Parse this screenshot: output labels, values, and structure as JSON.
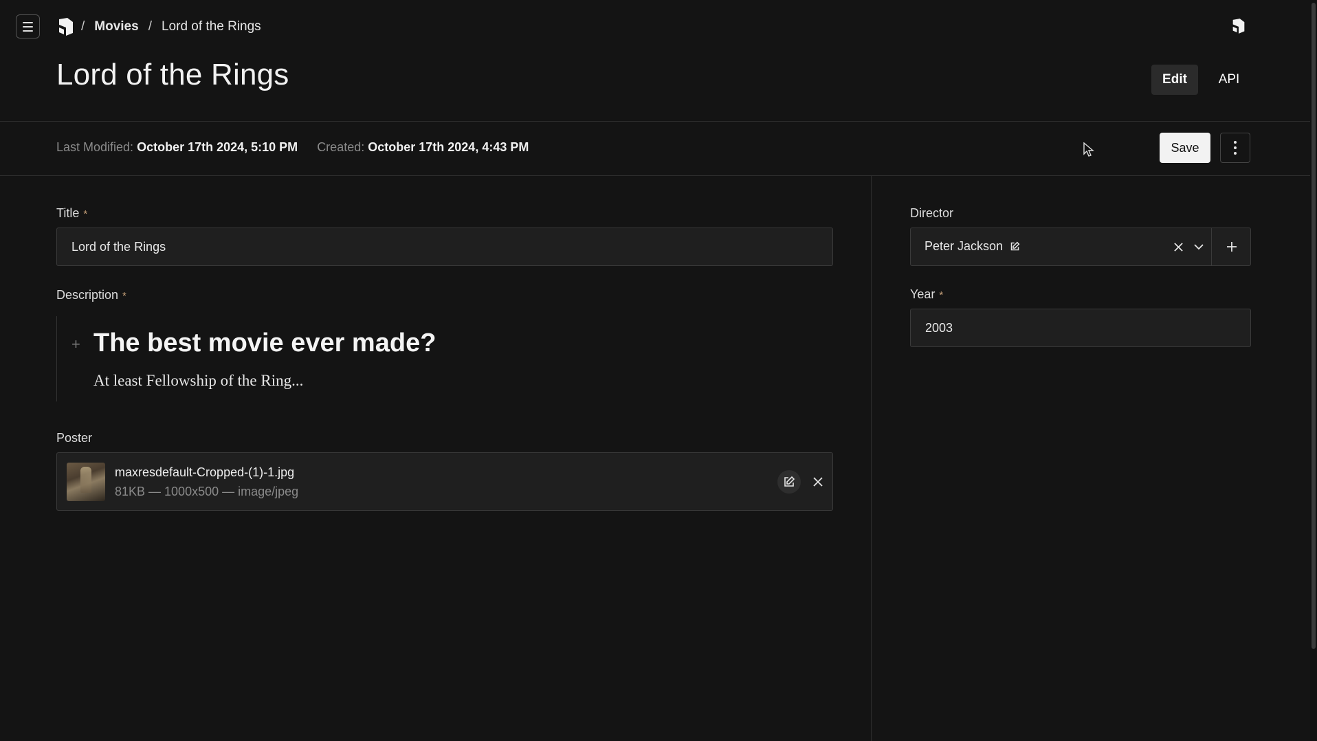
{
  "breadcrumb": {
    "collection": "Movies",
    "current": "Lord of the Rings"
  },
  "page": {
    "title": "Lord of the Rings"
  },
  "tabs": {
    "edit": "Edit",
    "api": "API"
  },
  "meta": {
    "last_modified_label": "Last Modified:",
    "last_modified_value": "October 17th 2024, 5:10 PM",
    "created_label": "Created:",
    "created_value": "October 17th 2024, 4:43 PM"
  },
  "toolbar": {
    "save_label": "Save"
  },
  "fields": {
    "title": {
      "label": "Title",
      "required_mark": "*",
      "value": "Lord of the Rings"
    },
    "description": {
      "label": "Description",
      "required_mark": "*",
      "heading": "The best movie ever made?",
      "paragraph": "At least Fellowship of the Ring..."
    },
    "poster": {
      "label": "Poster",
      "filename": "maxresdefault-Cropped-(1)-1.jpg",
      "details": "81KB — 1000x500 — image/jpeg"
    },
    "director": {
      "label": "Director",
      "value": "Peter Jackson"
    },
    "year": {
      "label": "Year",
      "required_mark": "*",
      "value": "2003"
    }
  },
  "icons": {
    "menu": "hamburger-icon",
    "logo": "payload-logo-icon",
    "more": "vertical-ellipsis-icon",
    "edit": "pencil-square-icon",
    "close": "x-icon",
    "chevron": "chevron-down-icon",
    "plus": "plus-icon"
  },
  "colors": {
    "background": "#141414",
    "required": "#c8a27a",
    "field_bg": "#1f1f1f"
  }
}
